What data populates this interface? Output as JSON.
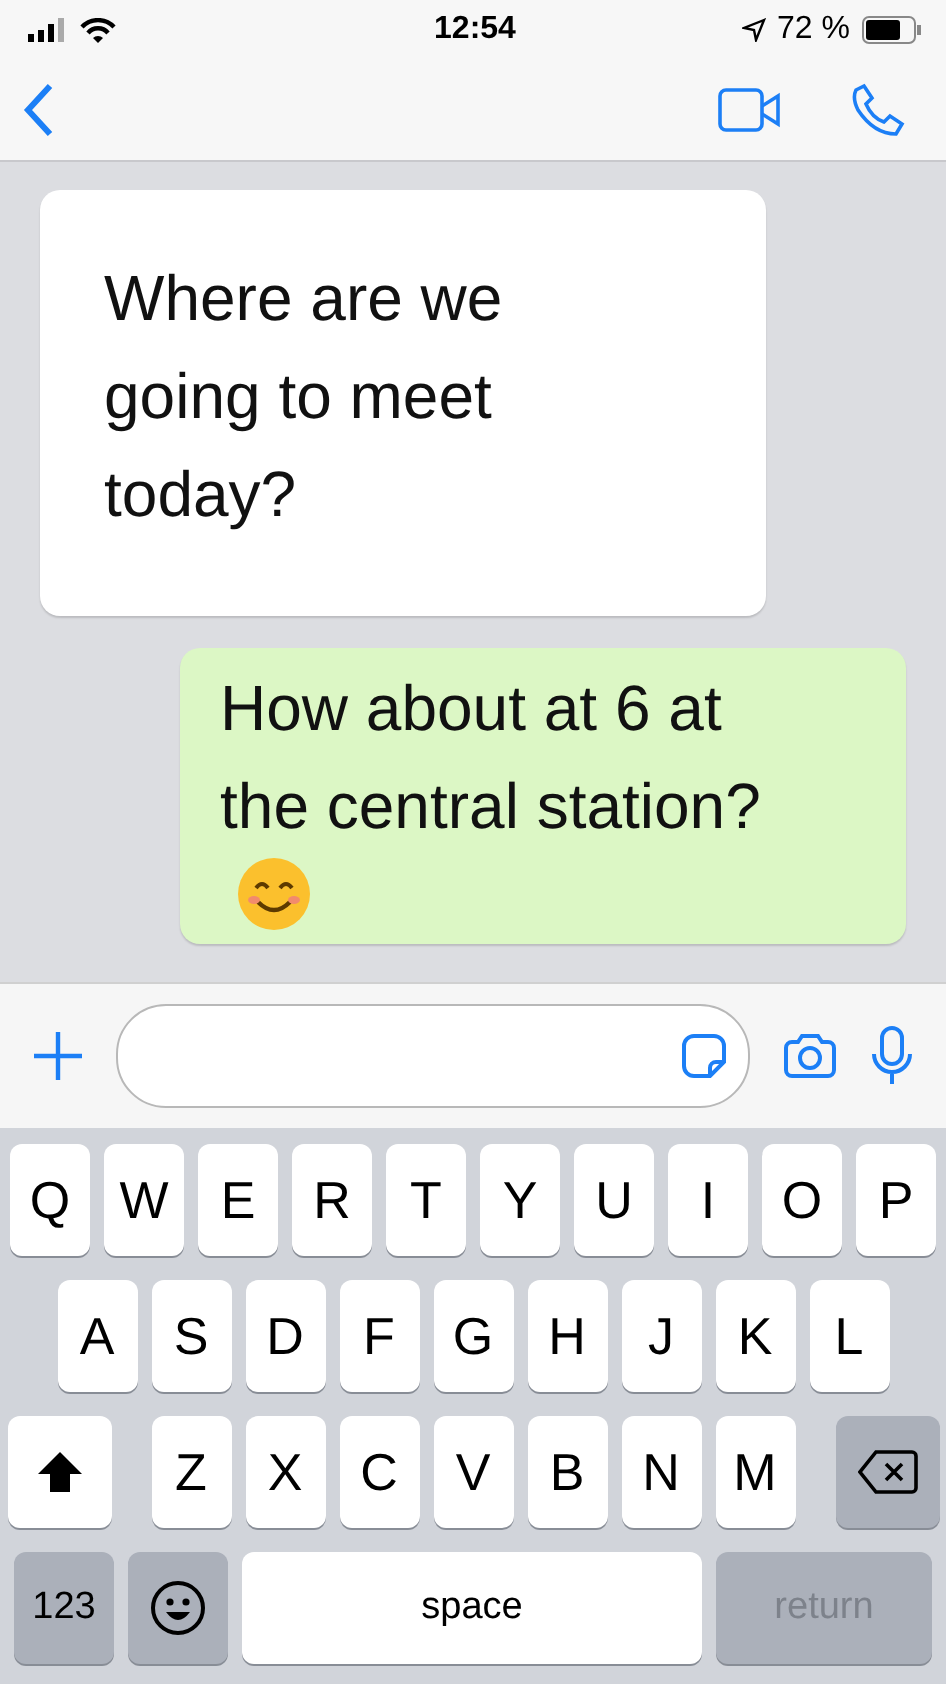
{
  "status_bar": {
    "time": "12:54",
    "battery": "72 %"
  },
  "messages": [
    {
      "kind": "received",
      "text": "Where are we going to meet today?",
      "emoji": false
    },
    {
      "kind": "sent",
      "text": "How about at 6 at the central station?",
      "emoji": true
    }
  ],
  "keyboard": {
    "rows": [
      [
        "Q",
        "W",
        "E",
        "R",
        "T",
        "Y",
        "U",
        "I",
        "O",
        "P"
      ],
      [
        "A",
        "S",
        "D",
        "F",
        "G",
        "H",
        "J",
        "K",
        "L"
      ],
      [
        "Z",
        "X",
        "C",
        "V",
        "B",
        "N",
        "M"
      ]
    ],
    "numbers_key": "123",
    "space_key": "space",
    "return_key": "return"
  }
}
